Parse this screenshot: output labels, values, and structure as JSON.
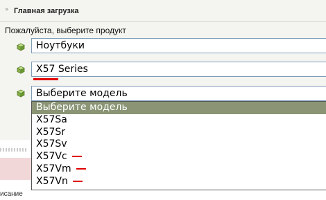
{
  "header": {
    "title": "Главная загрузка",
    "chevron_icon": "double-chevron-right-icon"
  },
  "prompt": "Пожалуйста, выберите продукт",
  "rows": [
    {
      "icon": "green-cube-icon",
      "value": "Ноутбуки"
    },
    {
      "icon": "green-cube-icon",
      "value": "X57 Series"
    },
    {
      "icon": "green-cube-icon",
      "value": "Выберите модель"
    }
  ],
  "dropdown": {
    "options": [
      "Выберите модель",
      "X57Sa",
      "X57Sr",
      "X57Sv",
      "X57Vc",
      "X57Vm",
      "X57Vn"
    ],
    "selected_index": 0
  },
  "footer_text": "исание",
  "colors": {
    "panel_bg": "#f4f4f0",
    "selected_option": "#8b9575",
    "annotation_red": "#e00000",
    "field_border": "#7f9db9"
  }
}
